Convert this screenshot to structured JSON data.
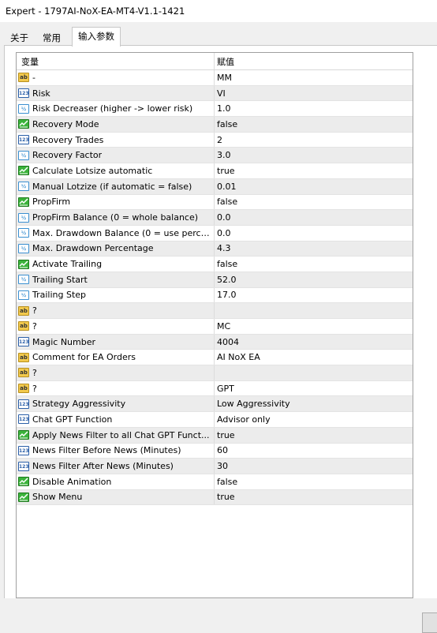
{
  "window": {
    "title": "Expert - 1797AI-NoX-EA-MT4-V1.1-1421"
  },
  "tabs": [
    {
      "label": "关于",
      "active": false
    },
    {
      "label": "常用",
      "active": false
    },
    {
      "label": "输入参数",
      "active": true
    }
  ],
  "table": {
    "headers": {
      "variable": "变量",
      "value": "赋值"
    },
    "rows": [
      {
        "icon": "string-icon",
        "name": "-",
        "value": "MM"
      },
      {
        "icon": "integer-icon",
        "name": "Risk",
        "value": "VI"
      },
      {
        "icon": "double-icon",
        "name": "Risk Decreaser (higher -> lower risk)",
        "value": "1.0"
      },
      {
        "icon": "bool-icon",
        "name": "Recovery Mode",
        "value": "false"
      },
      {
        "icon": "integer-icon",
        "name": "Recovery Trades",
        "value": "2"
      },
      {
        "icon": "double-icon",
        "name": "Recovery Factor",
        "value": "3.0"
      },
      {
        "icon": "bool-icon",
        "name": "Calculate Lotsize automatic",
        "value": "true"
      },
      {
        "icon": "double-icon",
        "name": "Manual Lotzize (if automatic = false)",
        "value": "0.01"
      },
      {
        "icon": "bool-icon",
        "name": "PropFirm",
        "value": "false"
      },
      {
        "icon": "double-icon",
        "name": "PropFirm Balance (0 = whole balance)",
        "value": "0.0"
      },
      {
        "icon": "double-icon",
        "name": "Max. Drawdown Balance (0 = use perce...",
        "value": "0.0"
      },
      {
        "icon": "double-icon",
        "name": "Max. Drawdown Percentage",
        "value": "4.3"
      },
      {
        "icon": "bool-icon",
        "name": "Activate Trailing",
        "value": "false"
      },
      {
        "icon": "double-icon",
        "name": "Trailing Start",
        "value": "52.0"
      },
      {
        "icon": "double-icon",
        "name": "Trailing Step",
        "value": "17.0"
      },
      {
        "icon": "string-icon",
        "name": "?",
        "value": ""
      },
      {
        "icon": "string-icon",
        "name": "?",
        "value": "MC"
      },
      {
        "icon": "integer-icon",
        "name": "Magic Number",
        "value": "4004"
      },
      {
        "icon": "string-icon",
        "name": "Comment for EA Orders",
        "value": "AI NoX EA"
      },
      {
        "icon": "string-icon",
        "name": "?",
        "value": ""
      },
      {
        "icon": "string-icon",
        "name": "?",
        "value": "GPT"
      },
      {
        "icon": "integer-icon",
        "name": "Strategy Aggressivity",
        "value": "Low Aggressivity"
      },
      {
        "icon": "integer-icon",
        "name": "Chat GPT Function",
        "value": "Advisor only"
      },
      {
        "icon": "bool-icon",
        "name": "Apply News Filter to all Chat GPT Funct...",
        "value": "true"
      },
      {
        "icon": "integer-icon",
        "name": "News Filter Before News (Minutes)",
        "value": "60"
      },
      {
        "icon": "integer-icon",
        "name": "News Filter After News (Minutes)",
        "value": "30"
      },
      {
        "icon": "bool-icon",
        "name": "Disable Animation",
        "value": "false"
      },
      {
        "icon": "bool-icon",
        "name": "Show Menu",
        "value": "true"
      }
    ]
  },
  "icon_glyphs": {
    "string-icon": "ab",
    "integer-icon": "123",
    "double-icon": "½"
  }
}
